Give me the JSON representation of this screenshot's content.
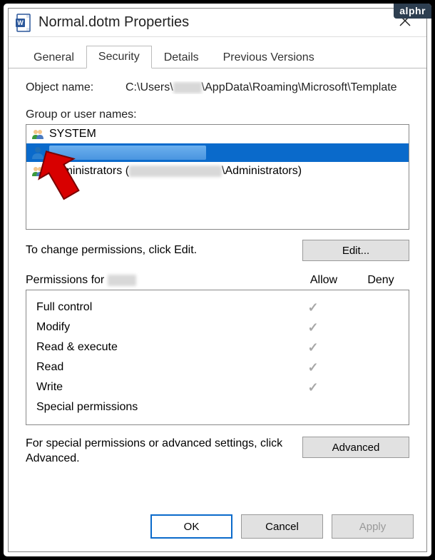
{
  "watermark": "alphr",
  "title": "Normal.dotm Properties",
  "tabs": [
    "General",
    "Security",
    "Details",
    "Previous Versions"
  ],
  "active_tab": "Security",
  "object_name_label": "Object name:",
  "object_name_value_prefix": "C:\\Users\\",
  "object_name_value_suffix": "\\AppData\\Roaming\\Microsoft\\Template",
  "group_label": "Group or user names:",
  "users": {
    "system": "SYSTEM",
    "admin_prefix": "Administrators (",
    "admin_suffix": "\\Administrators)"
  },
  "change_perm_text": "To change permissions, click Edit.",
  "edit_button": "Edit...",
  "perm_for_label": "Permissions for ",
  "allow_label": "Allow",
  "deny_label": "Deny",
  "permissions": [
    {
      "name": "Full control",
      "allow": true,
      "deny": false
    },
    {
      "name": "Modify",
      "allow": true,
      "deny": false
    },
    {
      "name": "Read & execute",
      "allow": true,
      "deny": false
    },
    {
      "name": "Read",
      "allow": true,
      "deny": false
    },
    {
      "name": "Write",
      "allow": true,
      "deny": false
    },
    {
      "name": "Special permissions",
      "allow": false,
      "deny": false
    }
  ],
  "advanced_text": "For special permissions or advanced settings, click Advanced.",
  "advanced_button": "Advanced",
  "footer": {
    "ok": "OK",
    "cancel": "Cancel",
    "apply": "Apply"
  }
}
